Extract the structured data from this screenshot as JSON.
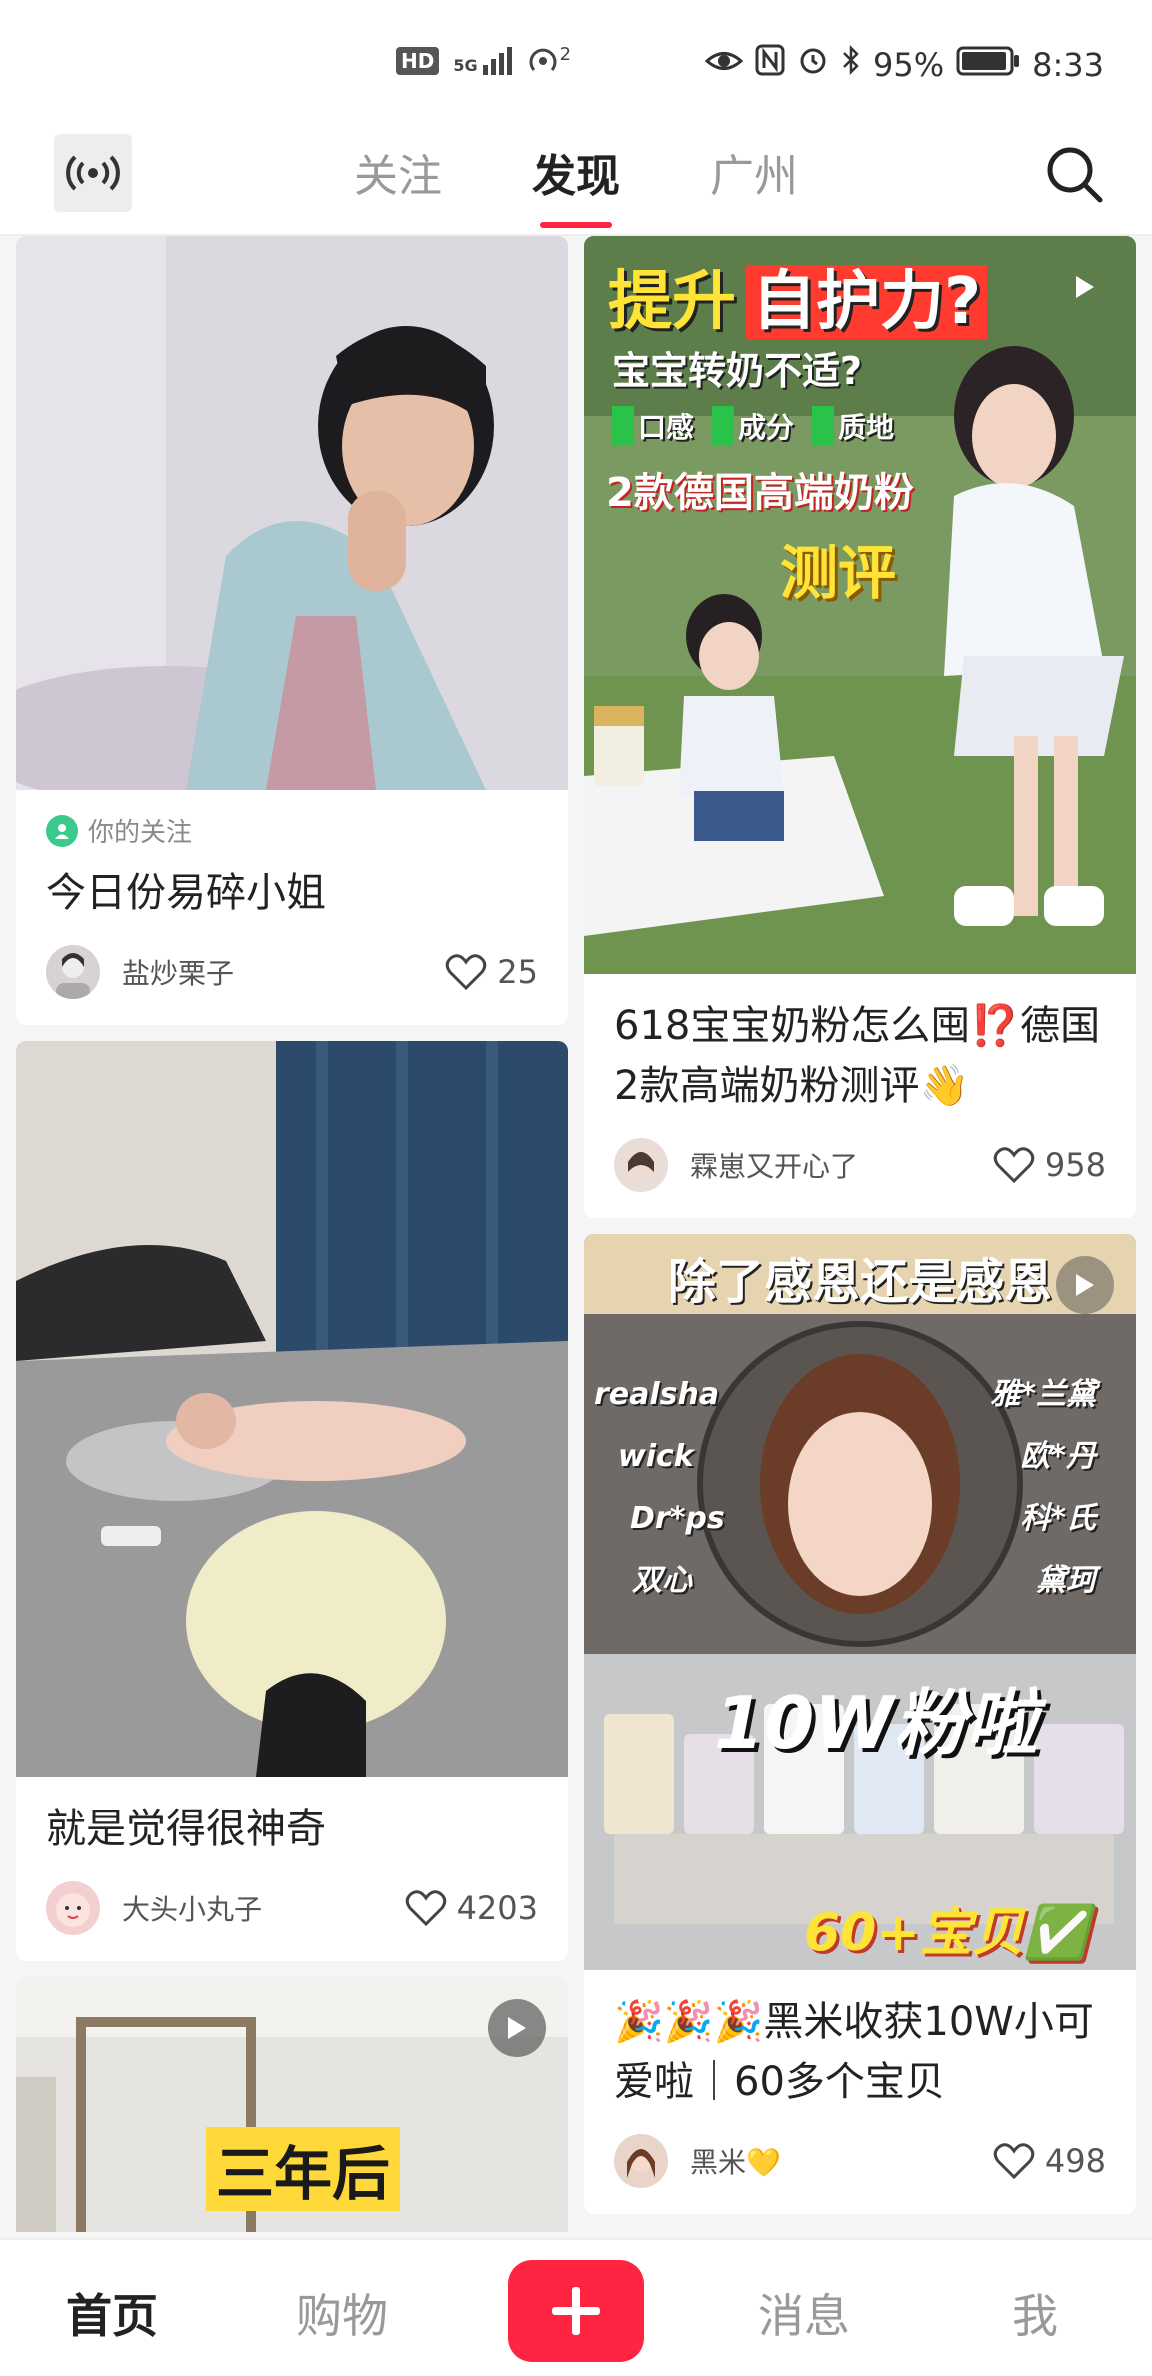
{
  "status_bar": {
    "signal_label": "HD",
    "network": "5G",
    "hotspot_count": "2",
    "battery": "95%",
    "time": "8:33"
  },
  "top_nav": {
    "tabs": [
      {
        "label": "关注"
      },
      {
        "label": "发现"
      },
      {
        "label": "广州"
      }
    ],
    "active_tab": "发现"
  },
  "feed": {
    "left": [
      {
        "tag": "你的关注",
        "title": "今日份易碎小姐",
        "author": "盐炒栗子",
        "likes": "25"
      },
      {
        "title": "就是觉得很神奇",
        "author": "大头小丸子",
        "likes": "4203"
      },
      {
        "overlay_text": "三年后",
        "has_video": true
      }
    ],
    "right": [
      {
        "has_video": true,
        "overlay": {
          "line1a": "提升",
          "line1b": "自护力?",
          "line2": "宝宝转奶不适?",
          "checks": [
            "口感",
            "成分",
            "质地"
          ],
          "line3": "2款德国高端奶粉",
          "line4": "测评"
        },
        "title": "618宝宝奶粉怎么囤⁉️德国2款高端奶粉测评👋",
        "author": "霖崽又开心了",
        "likes": "958"
      },
      {
        "has_video": true,
        "overlay": {
          "header": "除了感恩还是感恩",
          "brands_left": [
            "realsha",
            "wick",
            "Dr*ps",
            "双心"
          ],
          "brands_right": [
            "雅*兰黛",
            "欧*丹",
            "科*氏",
            "黛珂"
          ],
          "big": "10W粉啦",
          "footer": "60+宝贝✅"
        },
        "title": "🎉🎉🎉黑米收获10W小可爱啦｜60多个宝贝",
        "author": "黑米💛",
        "likes": "498"
      }
    ]
  },
  "bottom_nav": {
    "items": [
      {
        "label": "首页"
      },
      {
        "label": "购物"
      },
      {
        "label": "消息"
      },
      {
        "label": "我"
      }
    ],
    "active": "首页"
  },
  "colors": {
    "accent": "#ff2442",
    "follow_green": "#3cc98e"
  }
}
